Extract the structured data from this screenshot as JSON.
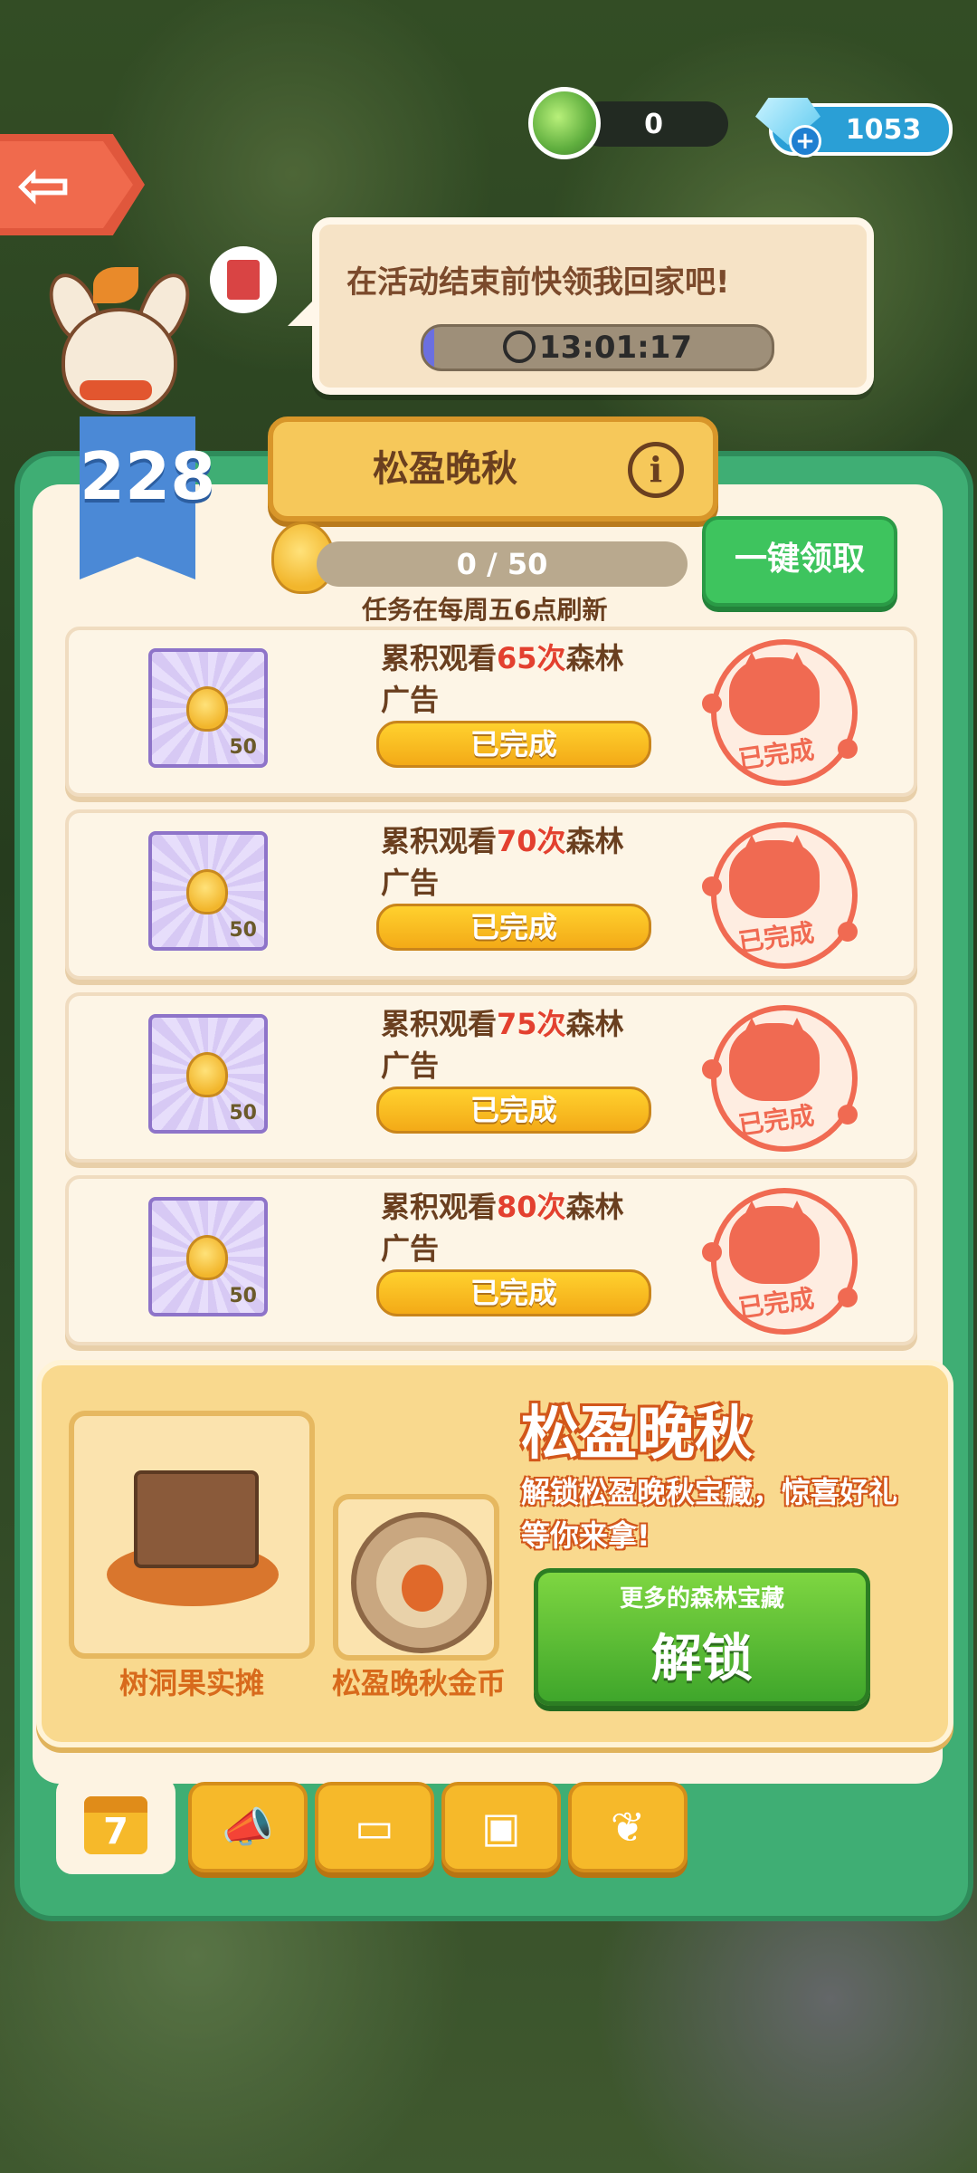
{
  "currency": {
    "teapot_count": "0",
    "gems": "1053"
  },
  "bubble": {
    "message": "在活动结束前快领我回家吧!",
    "timer": "13:01:17",
    "timer_progress": 0.03
  },
  "level_badge": "228",
  "panel": {
    "title": "松盈晚秋",
    "progress_text": "0 / 50",
    "progress_value": 0,
    "progress_max": 50,
    "refresh_note": "任务在每周五6点刷新",
    "claim_all_label": "一键领取"
  },
  "tasks": [
    {
      "desc_pre": "累积观看",
      "count": "65次",
      "desc_post": "森林广告",
      "reward_qty": "50",
      "button": "已完成",
      "stamp": "已完成"
    },
    {
      "desc_pre": "累积观看",
      "count": "70次",
      "desc_post": "森林广告",
      "reward_qty": "50",
      "button": "已完成",
      "stamp": "已完成"
    },
    {
      "desc_pre": "累积观看",
      "count": "75次",
      "desc_post": "森林广告",
      "reward_qty": "50",
      "button": "已完成",
      "stamp": "已完成"
    },
    {
      "desc_pre": "累积观看",
      "count": "80次",
      "desc_post": "森林广告",
      "reward_qty": "50",
      "button": "已完成",
      "stamp": "已完成"
    }
  ],
  "promo": {
    "title": "松盈晚秋",
    "description": "解锁松盈晚秋宝藏，惊喜好礼等你来拿!",
    "item1_label": "树洞果实摊",
    "item2_label": "松盈晚秋金币",
    "unlock_sub": "更多的森林宝藏",
    "unlock_label": "解锁"
  },
  "tabs": [
    {
      "icon": "calendar-icon",
      "label": "7",
      "active": true
    },
    {
      "icon": "megaphone-icon",
      "active": false
    },
    {
      "icon": "tickets-icon",
      "active": false
    },
    {
      "icon": "gift-box-icon",
      "active": false
    },
    {
      "icon": "leaf-icon",
      "active": false
    }
  ],
  "colors": {
    "panel_green": "#3fae74",
    "accent_orange": "#f6b92a",
    "highlight_red": "#e3402f",
    "stamp_red": "#f06a52"
  }
}
